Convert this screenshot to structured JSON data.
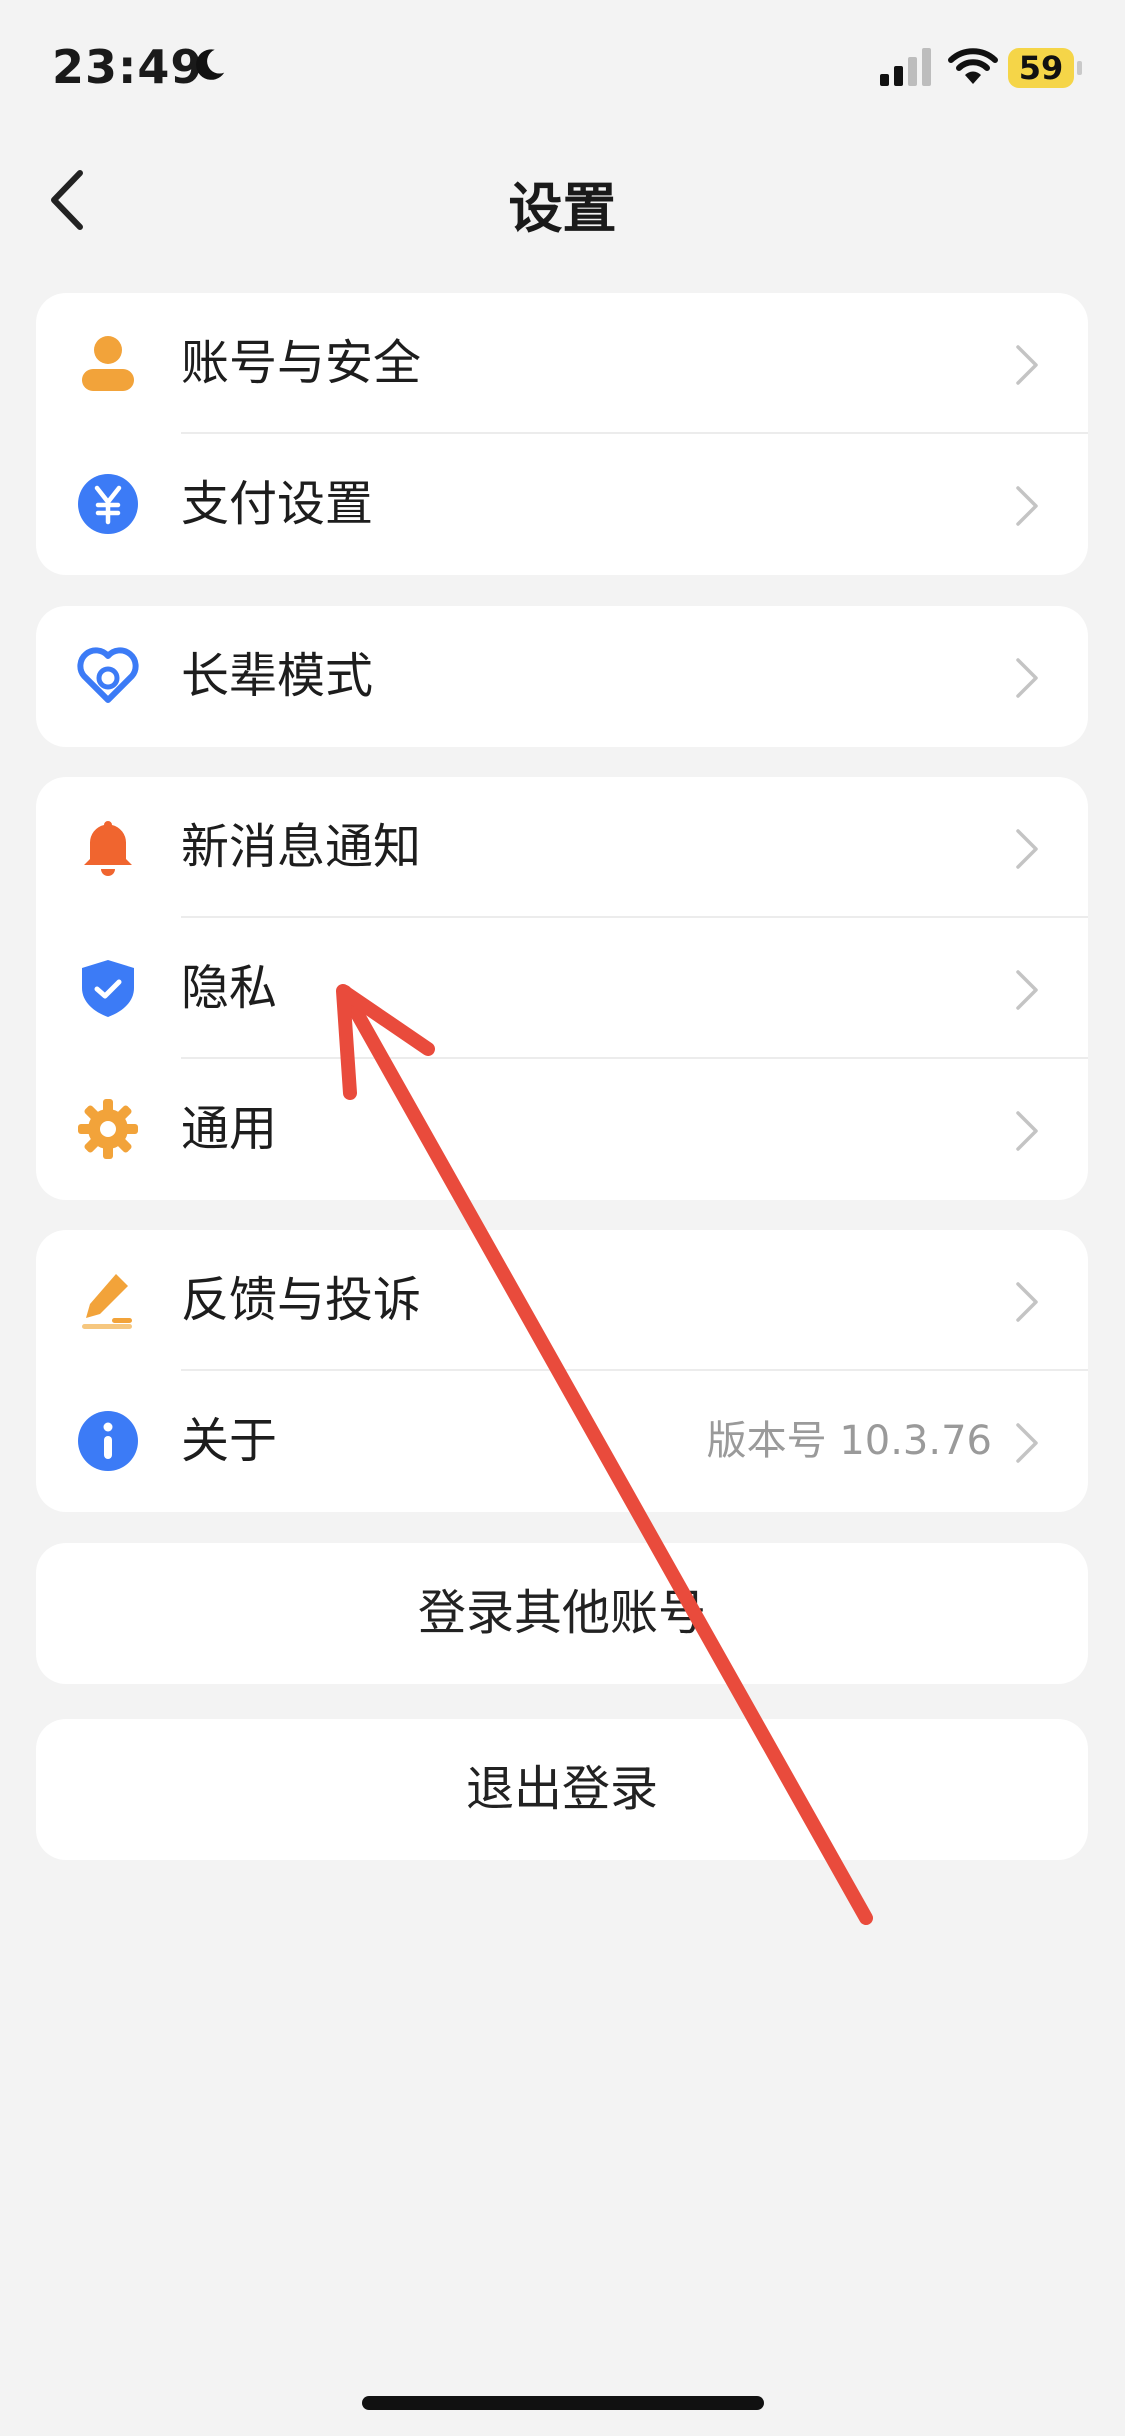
{
  "status": {
    "time": "23:49",
    "battery": "59",
    "icons": [
      "moon-icon",
      "signal-icon",
      "wifi-icon",
      "battery-icon"
    ]
  },
  "header": {
    "title": "设置"
  },
  "groups": [
    {
      "items": [
        {
          "label": "账号与安全",
          "icon": "account-icon",
          "icon_color": "#f2a33a"
        },
        {
          "label": "支付设置",
          "icon": "payment-yuan-icon",
          "icon_color": "#3c7bf6"
        }
      ]
    },
    {
      "items": [
        {
          "label": "长辈模式",
          "icon": "elder-heart-icon",
          "icon_color": "#3c7bf6"
        }
      ]
    },
    {
      "items": [
        {
          "label": "新消息通知",
          "icon": "bell-icon",
          "icon_color": "#f0652f"
        },
        {
          "label": "隐私",
          "icon": "privacy-shield-icon",
          "icon_color": "#3c7bf6"
        },
        {
          "label": "通用",
          "icon": "gear-icon",
          "icon_color": "#f2a33a"
        }
      ]
    },
    {
      "items": [
        {
          "label": "反馈与投诉",
          "icon": "feedback-pencil-icon",
          "icon_color": "#f2a33a"
        },
        {
          "label": "关于",
          "icon": "info-icon",
          "icon_color": "#3c7bf6",
          "value": "版本号 10.3.76"
        }
      ]
    }
  ],
  "actions": {
    "switch_account": "登录其他账号",
    "logout": "退出登录"
  },
  "annotation": {
    "arrow_color": "#e94b3c"
  }
}
